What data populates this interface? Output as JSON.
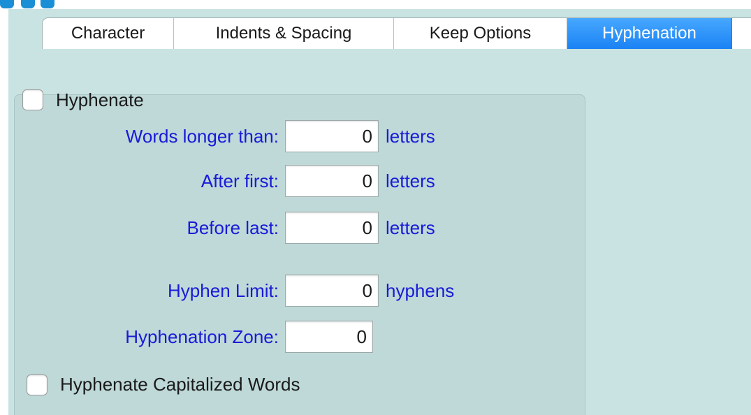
{
  "tabs": [
    {
      "label": "Character",
      "active": false
    },
    {
      "label": "Indents & Spacing",
      "active": false
    },
    {
      "label": "Keep Options",
      "active": false
    },
    {
      "label": "Hyphenation",
      "active": true
    }
  ],
  "hyphenate": {
    "label": "Hyphenate",
    "checked": false
  },
  "fields": {
    "words_longer_than": {
      "label": "Words longer than:",
      "value": "0",
      "unit": "letters"
    },
    "after_first": {
      "label": "After first:",
      "value": "0",
      "unit": "letters"
    },
    "before_last": {
      "label": "Before last:",
      "value": "0",
      "unit": "letters"
    },
    "hyphen_limit": {
      "label": "Hyphen Limit:",
      "value": "0",
      "unit": "hyphens"
    },
    "hyphenation_zone": {
      "label": "Hyphenation Zone:",
      "value": "0"
    }
  },
  "hyphenate_capitalized": {
    "label": "Hyphenate Capitalized Words",
    "checked": false
  },
  "colors": {
    "panel_background": "#c9e3e2",
    "group_background": "#bed9d8",
    "label_blue": "#1a1ad8",
    "active_tab": "#1a82f4"
  }
}
